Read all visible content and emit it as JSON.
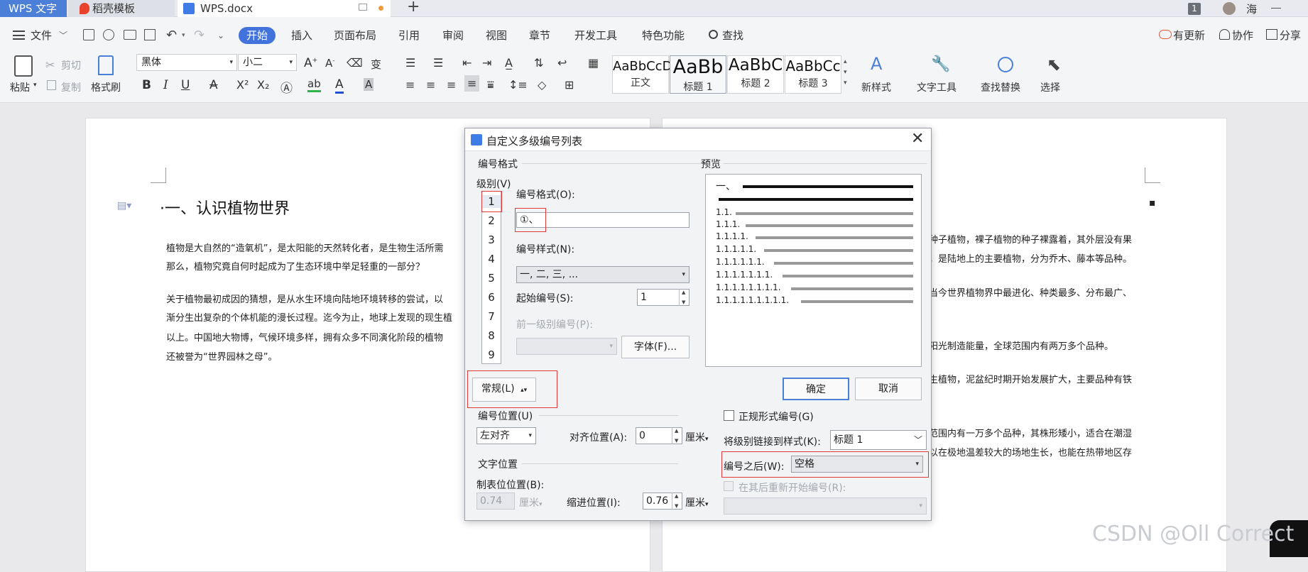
{
  "tabs": {
    "app": "WPS 文字",
    "template": "稻壳模板",
    "doc": "WPS.docx",
    "new": "+",
    "badge": "1",
    "user": "海"
  },
  "menu": {
    "file": "文件",
    "items": [
      "开始",
      "插入",
      "页面布局",
      "引用",
      "审阅",
      "视图",
      "章节",
      "开发工具",
      "特色功能"
    ],
    "search": "查找",
    "right": [
      "有更新",
      "协作",
      "分享"
    ]
  },
  "ribbon": {
    "paste": "粘贴",
    "cut": "剪切",
    "copy": "复制",
    "format_painter": "格式刷",
    "font_name": "黑体",
    "font_size": "小二",
    "styles": [
      {
        "preview": "AaBbCcD",
        "name": "正文"
      },
      {
        "preview": "AaBb",
        "name": "标题 1"
      },
      {
        "preview": "AaBbC",
        "name": "标题 2"
      },
      {
        "preview": "AaBbCc",
        "name": "标题 3"
      }
    ],
    "new_style": "新样式",
    "text_tools": "文字工具",
    "find_replace": "查找替换",
    "select": "选择"
  },
  "document": {
    "heading": "·一、认识植物世界",
    "p1": [
      "植物是大自然的“造氧机”，是太阳能的天然转化者，是生物生活所需",
      "那么，植物究竟自何时起成为了生态环境中举足轻重的一部分？"
    ],
    "p2": [
      "关于植物最初成因的猜想，是从水生环境向陆地环境转移的尝试，以",
      "渐分生出复杂的个体机能的漫长过程。迄今为止，地球上发现的现生植",
      "以上。中国地大物博，气候环境多样，拥有众多不同演化阶段的植物",
      "还被誉为“世界园林之母”。"
    ],
    "right_lines": [
      "种子植物，裸子植物的种子裸露着，其外层没有果",
      "，是陆地上的主要植物，分为乔木、藤本等品种。",
      "当今世界植物界中最进化、种类最多、分布最广、",
      "阳光制造能量，全球范围内有两万多个品种。",
      "生植物，泥盆纪时期开始发展扩大，主要品种有铁",
      "范围内有一万多个品种，其株形矮小，适合在潮湿",
      "以在极地温差较大的场地生长，也能在热带地区存"
    ]
  },
  "dialog": {
    "title": "自定义多级编号列表",
    "number_format_group": "编号格式",
    "level_label": "级别(V)",
    "levels": [
      "1",
      "2",
      "3",
      "4",
      "5",
      "6",
      "7",
      "8",
      "9"
    ],
    "format_label": "编号格式(O):",
    "format_value": "①、",
    "style_label": "编号样式(N):",
    "style_value": "一, 二, 三, ...",
    "start_label": "起始编号(S):",
    "start_value": "1",
    "prev_level_label": "前一级别编号(P):",
    "font_button": "字体(F)...",
    "preview_label": "预览",
    "preview_items": [
      "一、",
      "1.1.",
      "1.1.1.",
      "1.1.1.1.",
      "1.1.1.1.1.",
      "1.1.1.1.1.1.",
      "1.1.1.1.1.1.1.",
      "1.1.1.1.1.1.1.1.",
      "1.1.1.1.1.1.1.1.1."
    ],
    "ok": "确定",
    "cancel": "取消",
    "normal_button": "常规(L)",
    "position_group": "编号位置(U)",
    "align_value": "左对齐",
    "align_pos_label": "对齐位置(A):",
    "align_pos_value": "0",
    "unit": "厘米",
    "text_pos_group": "文字位置",
    "tab_pos_label": "制表位位置(B):",
    "tab_pos_value": "0.74",
    "indent_label": "缩进位置(I):",
    "indent_value": "0.76",
    "legal_label": "正规形式编号(G)",
    "link_label": "将级别链接到样式(K):",
    "link_value": "标题 1",
    "after_label": "编号之后(W):",
    "after_value": "空格",
    "restart_label": "在其后重新开始编号(R):"
  },
  "watermark": "CSDN @Oll Correct"
}
